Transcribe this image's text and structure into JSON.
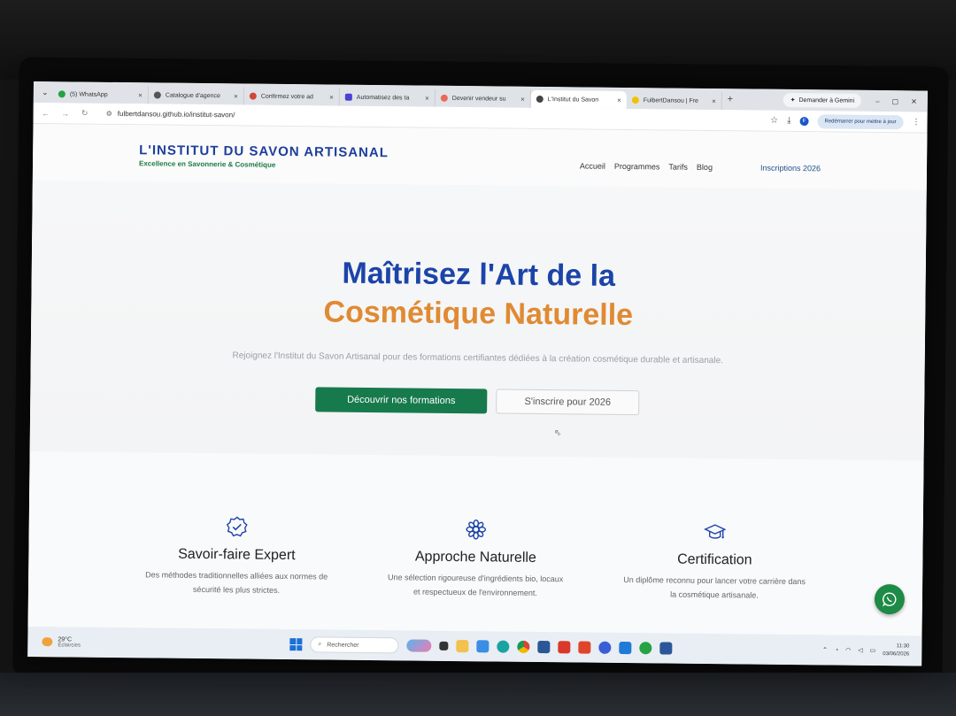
{
  "browser": {
    "tabs": [
      {
        "label": "(5) WhatsApp",
        "color": "#25a244",
        "active": false
      },
      {
        "label": "Catalogue d'agence",
        "color": "#555555",
        "active": false
      },
      {
        "label": "Confirmez votre ad",
        "color": "#d44638",
        "active": false
      },
      {
        "label": "Automatisez des ta",
        "color": "#4b3fd6",
        "active": false
      },
      {
        "label": "Devenir vendeur su",
        "color": "#e96a5a",
        "active": false
      },
      {
        "label": "L'Institut du Savon",
        "color": "#444444",
        "active": true
      },
      {
        "label": "FulbertDansou | Fre",
        "color": "#f2c200",
        "active": false
      }
    ],
    "gemini_label": "Demander à Gemini",
    "url": "fulbertdansou.github.io/institut-savon/",
    "profile_initial": "F",
    "resume_label": "Redémarrer pour mettre à jour"
  },
  "site": {
    "brand": {
      "name": "L'INSTITUT DU SAVON ARTISANAL",
      "tagline": "Excellence en Savonnerie & Cosmétique"
    },
    "nav": {
      "home": "Accueil",
      "programs": "Programmes",
      "pricing": "Tarifs",
      "blog": "Blog",
      "cta": "Inscriptions 2026"
    },
    "hero": {
      "title_line1": "Maîtrisez l'Art de la",
      "title_line2": "Cosmétique Naturelle",
      "subtitle": "Rejoignez l'Institut du Savon Artisanal pour des formations certifiantes dédiées à la création cosmétique durable et artisanale.",
      "primary_button": "Découvrir nos formations",
      "secondary_button": "S'inscrire pour 2026"
    },
    "features": [
      {
        "title": "Savoir-faire Expert",
        "desc_line1": "Des méthodes traditionnelles alliées aux normes de",
        "desc_line2": "sécurité les plus strictes."
      },
      {
        "title": "Approche Naturelle",
        "desc_line1": "Une sélection rigoureuse d'ingrédients bio, locaux",
        "desc_line2": "et respectueux de l'environnement."
      },
      {
        "title": "Certification",
        "desc_line1": "Un diplôme reconnu pour lancer votre carrière dans",
        "desc_line2": "la cosmétique artisanale."
      }
    ],
    "colors": {
      "brand_blue": "#1c44a8",
      "accent_orange": "#e08a33",
      "primary_green": "#177a4c"
    }
  },
  "taskbar": {
    "weather_temp": "29°C",
    "weather_desc": "Éclaircies",
    "search_placeholder": "Rechercher",
    "time": "11:30",
    "date": "03/06/2026"
  }
}
